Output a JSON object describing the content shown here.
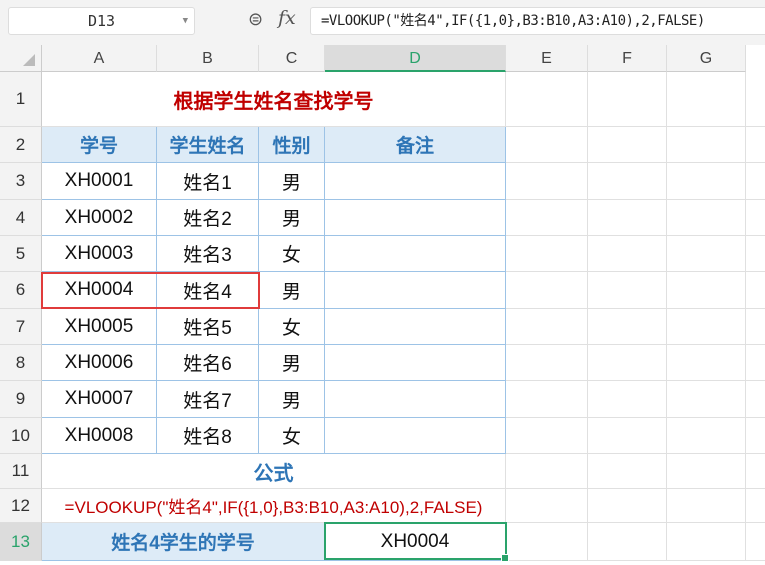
{
  "name_box": "D13",
  "formula_bar": "=VLOOKUP(\"姓名4\",IF({1,0},B3:B10,A3:A10),2,FALSE)",
  "columns": [
    "A",
    "B",
    "C",
    "D",
    "E",
    "F",
    "G"
  ],
  "rows": [
    "1",
    "2",
    "3",
    "4",
    "5",
    "6",
    "7",
    "8",
    "9",
    "10",
    "11",
    "12",
    "13"
  ],
  "title": "根据学生姓名查找学号",
  "headers": [
    "学号",
    "学生姓名",
    "性别",
    "备注"
  ],
  "students": [
    [
      "XH0001",
      "姓名1",
      "男"
    ],
    [
      "XH0002",
      "姓名2",
      "男"
    ],
    [
      "XH0003",
      "姓名3",
      "女"
    ],
    [
      "XH0004",
      "姓名4",
      "男"
    ],
    [
      "XH0005",
      "姓名5",
      "女"
    ],
    [
      "XH0006",
      "姓名6",
      "男"
    ],
    [
      "XH0007",
      "姓名7",
      "男"
    ],
    [
      "XH0008",
      "姓名8",
      "女"
    ]
  ],
  "section_label": "公式",
  "formula_text": "=VLOOKUP(\"姓名4\",IF({1,0},B3:B10,A3:A10),2,FALSE)",
  "result_label": "姓名4学生的学号",
  "result_value": "XH0004"
}
